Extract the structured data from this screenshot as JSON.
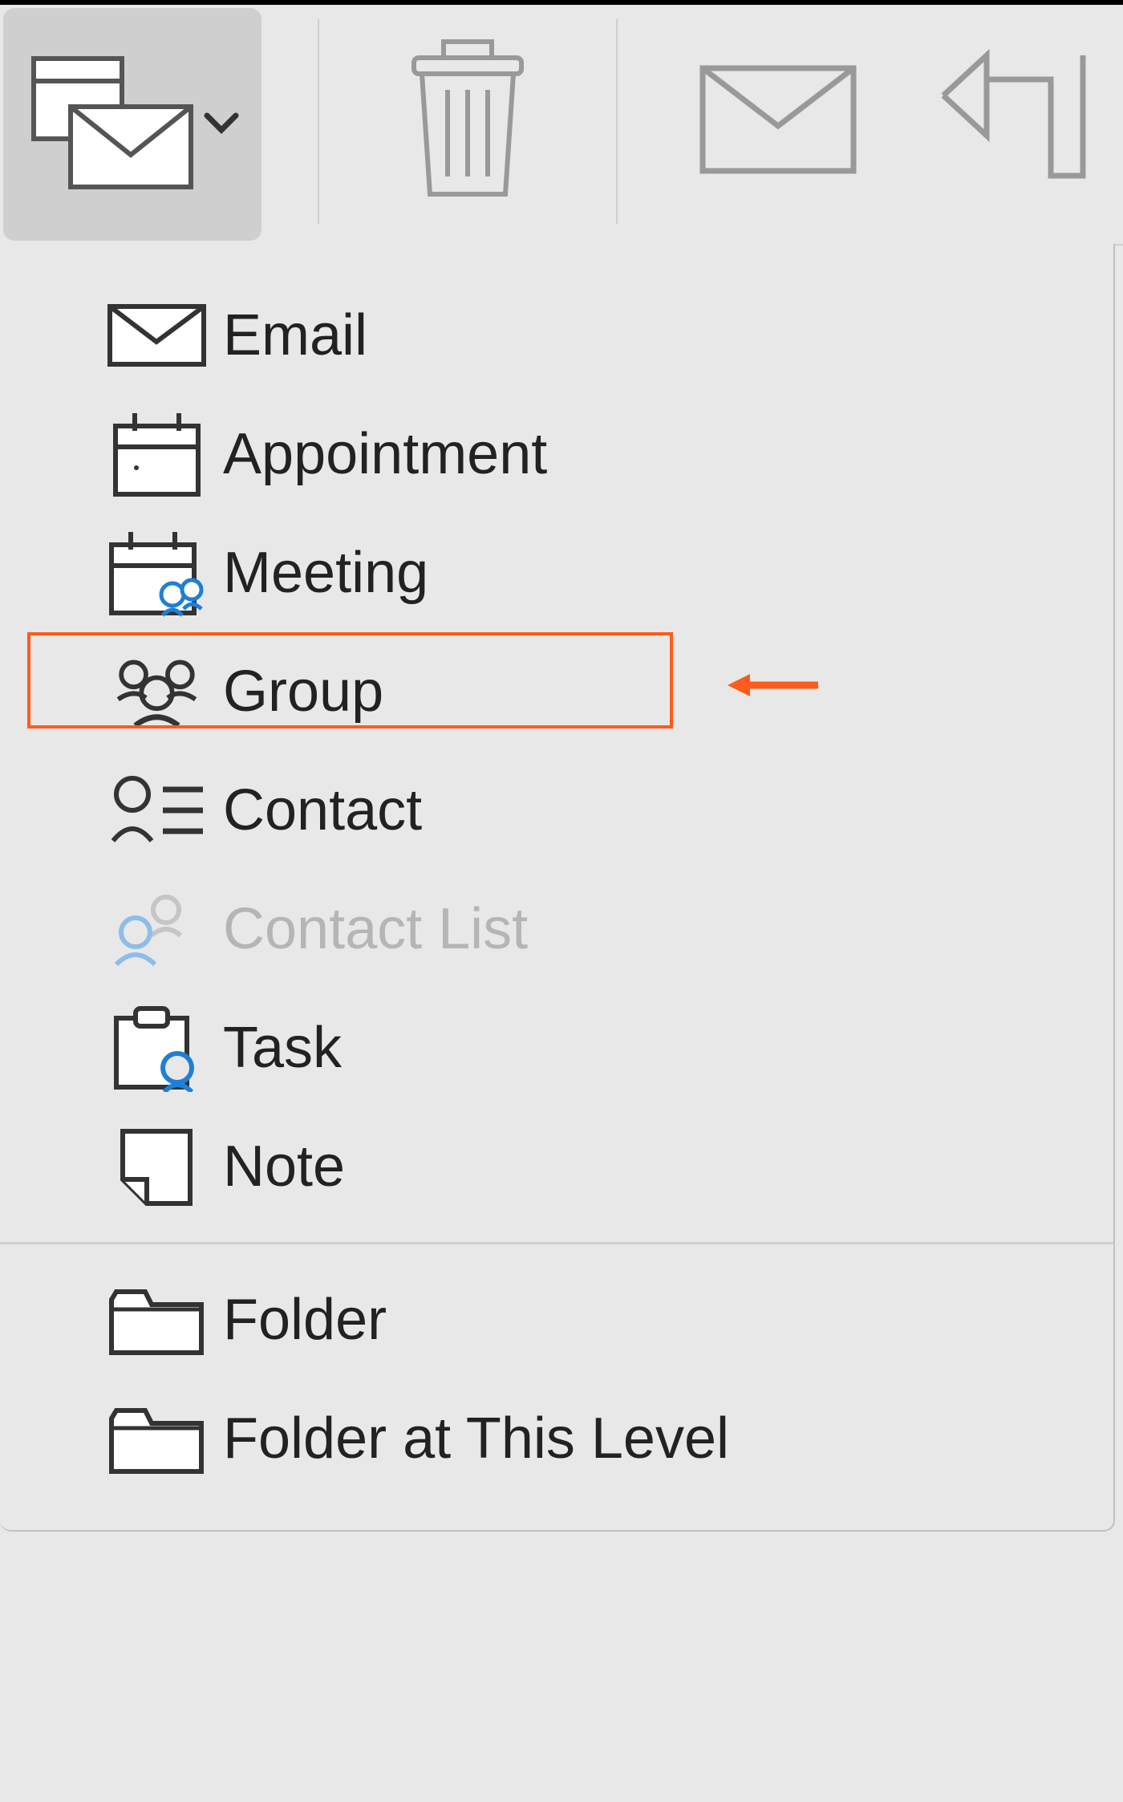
{
  "toolbar": {
    "new_button": "New",
    "delete_button": "Delete",
    "mail_button": "Mail",
    "reply_button": "Reply"
  },
  "menu": {
    "items": [
      {
        "label": "Email",
        "icon": "email-icon",
        "enabled": true
      },
      {
        "label": "Appointment",
        "icon": "appointment-icon",
        "enabled": true
      },
      {
        "label": "Meeting",
        "icon": "meeting-icon",
        "enabled": true
      },
      {
        "label": "Group",
        "icon": "group-icon",
        "enabled": true,
        "highlighted": true
      },
      {
        "label": "Contact",
        "icon": "contact-icon",
        "enabled": true
      },
      {
        "label": "Contact List",
        "icon": "contact-list-icon",
        "enabled": false
      },
      {
        "label": "Task",
        "icon": "task-icon",
        "enabled": true
      },
      {
        "label": "Note",
        "icon": "note-icon",
        "enabled": true
      }
    ],
    "items_section2": [
      {
        "label": "Folder",
        "icon": "folder-icon",
        "enabled": true
      },
      {
        "label": "Folder at This Level",
        "icon": "folder-level-icon",
        "enabled": true
      }
    ]
  },
  "annotation": {
    "highlight_color": "#ff5b1c"
  }
}
